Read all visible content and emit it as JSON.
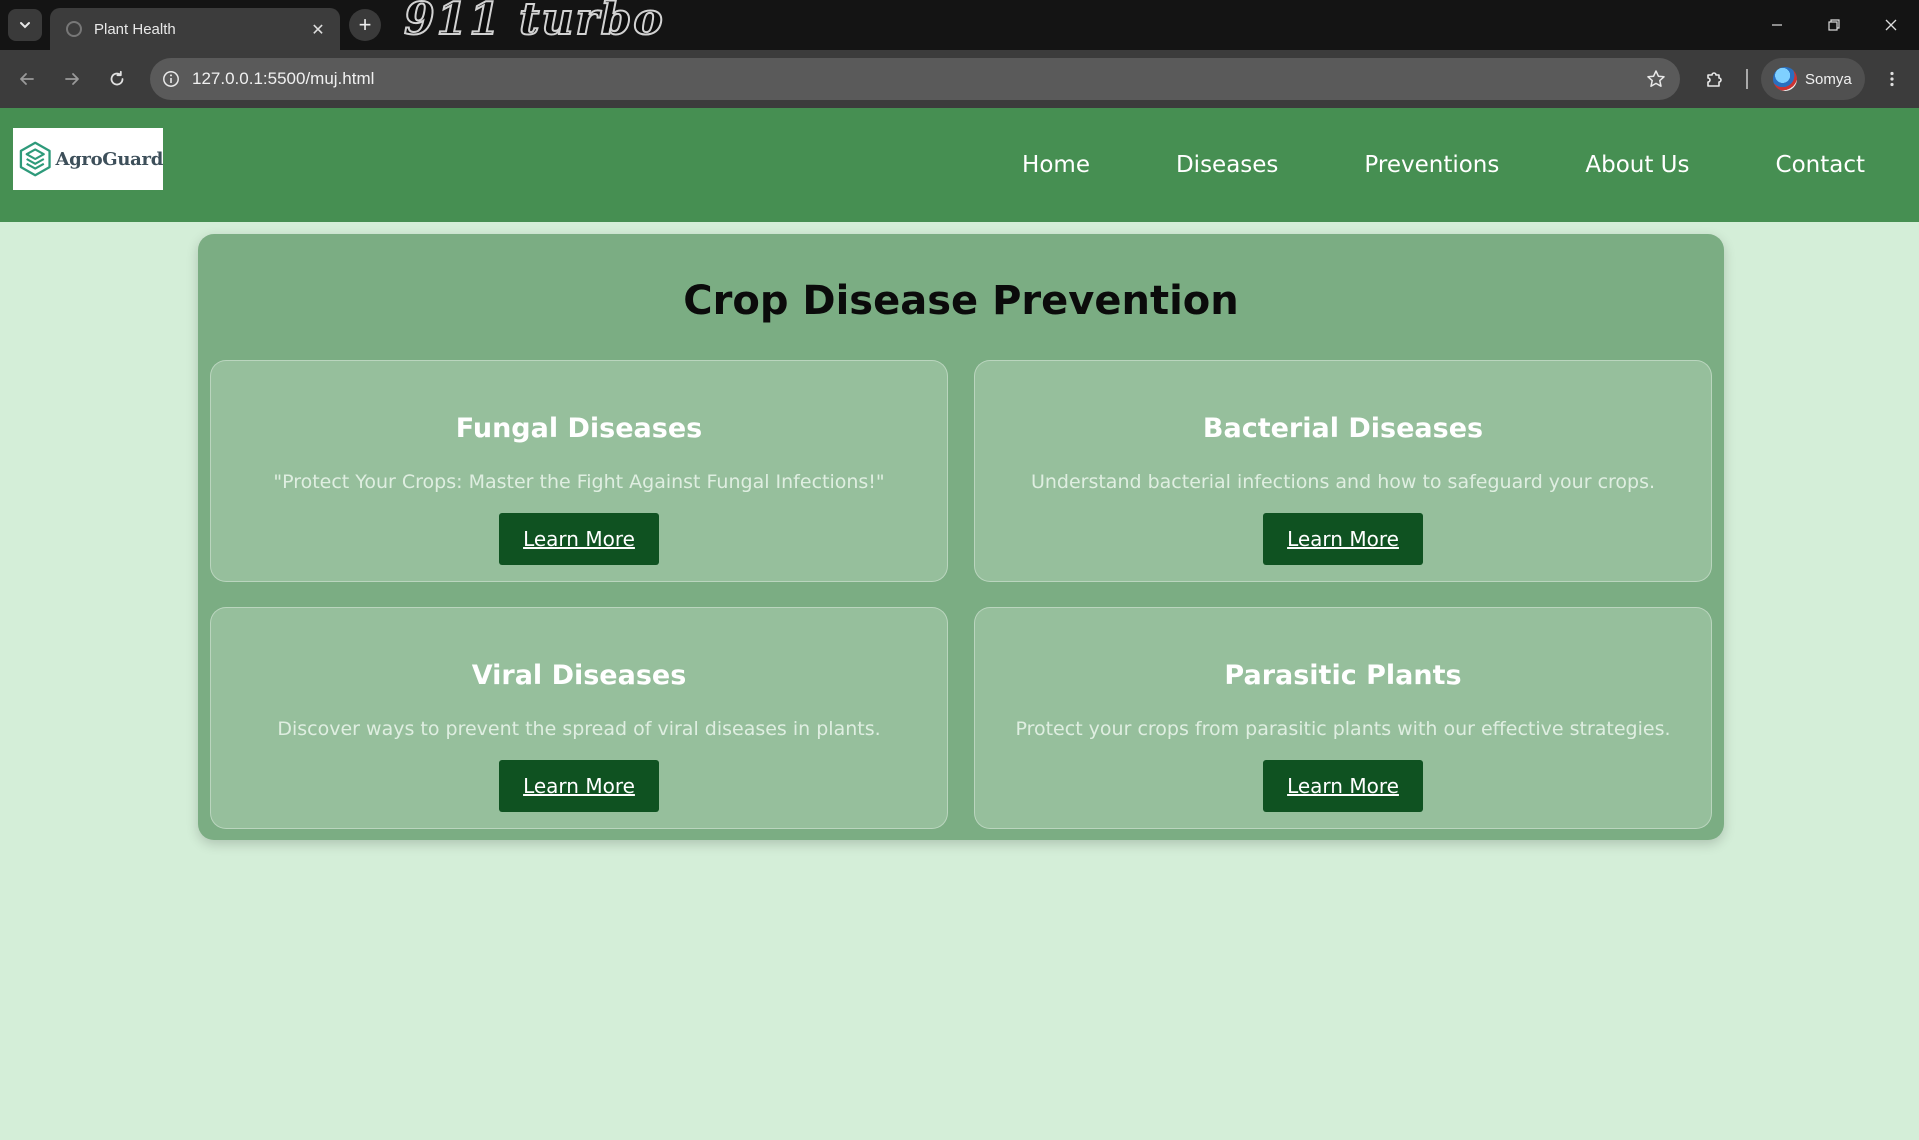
{
  "browser": {
    "tab_title": "Plant Health",
    "theme_wordmark": "911 turbo",
    "url": "127.0.0.1:5500/muj.html",
    "profile_name": "Somya"
  },
  "site": {
    "logo_text": "AgroGuard",
    "nav": [
      "Home",
      "Diseases",
      "Preventions",
      "About Us",
      "Contact"
    ]
  },
  "main": {
    "title": "Crop Disease Prevention",
    "cards": [
      {
        "title": "Fungal Diseases",
        "description": "\"Protect Your Crops: Master the Fight Against Fungal Infections!\"",
        "button": "Learn More"
      },
      {
        "title": "Bacterial Diseases",
        "description": "Understand bacterial infections and how to safeguard your crops.",
        "button": "Learn More"
      },
      {
        "title": "Viral Diseases",
        "description": "Discover ways to prevent the spread of viral diseases in plants.",
        "button": "Learn More"
      },
      {
        "title": "Parasitic Plants",
        "description": "Protect your crops from parasitic plants with our effective strategies.",
        "button": "Learn More"
      }
    ]
  },
  "colors": {
    "header_bg": "#468f52",
    "page_bg": "#d4eed8",
    "panel_bg": "#7bad83",
    "card_bg": "#96bf9c",
    "button_bg": "#0f5221"
  }
}
